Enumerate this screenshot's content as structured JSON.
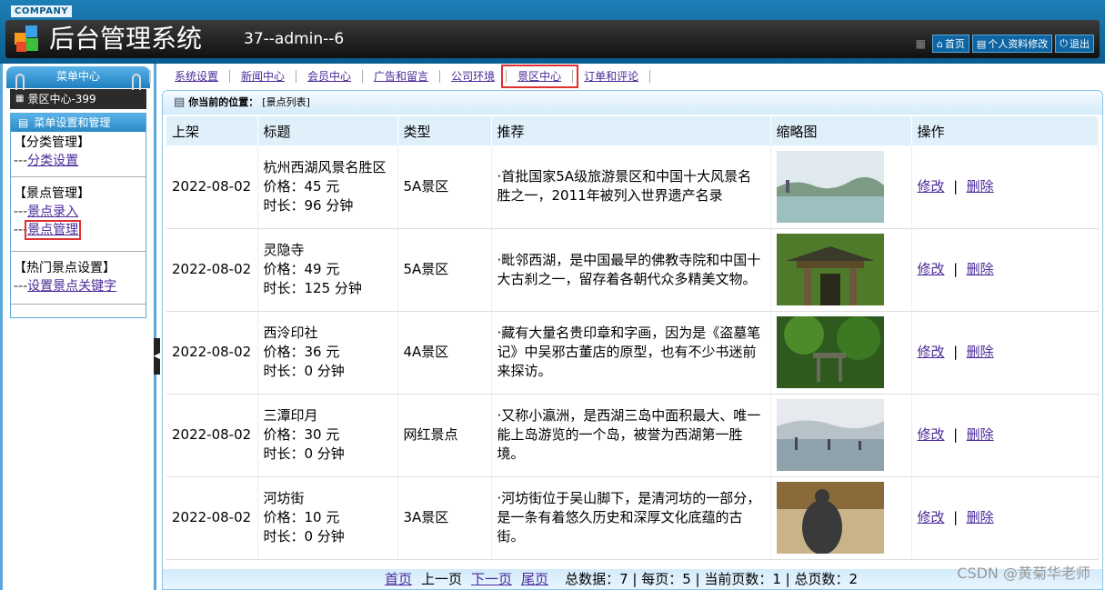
{
  "header": {
    "company": "COMPANY",
    "title": "后台管理系统",
    "user": "37--admin--6",
    "links": [
      "首页",
      "个人资料修改",
      "退出"
    ]
  },
  "sidebar": {
    "menu_title": "菜单中心",
    "center_label": "景区中心-399",
    "box_title": "菜单设置和管理",
    "groups": [
      {
        "title": "【分类管理】",
        "items": [
          "分类设置"
        ]
      },
      {
        "title": "【景点管理】",
        "items": [
          "景点录入",
          "景点管理"
        ]
      },
      {
        "title": "【热门景点设置】",
        "items": [
          "设置景点关键字"
        ]
      }
    ]
  },
  "tabs": [
    "系统设置",
    "新闻中心",
    "会员中心",
    "广告和留言",
    "公司环境",
    "景区中心",
    "订单和评论"
  ],
  "location": {
    "label": "你当前的位置：",
    "value": "[景点列表]"
  },
  "table": {
    "headers": [
      "上架",
      "标题",
      "类型",
      "推荐",
      "缩略图",
      "操作"
    ],
    "rows": [
      {
        "date": "2022-08-02",
        "title": "杭州西湖风景名胜区",
        "price": "价格：45 元",
        "duration": "时长：96 分钟",
        "type": "5A景区",
        "desc": "·首批国家5A级旅游景区和中国十大风景名胜之一，2011年被列入世界遗产名录",
        "thumb": "lake-scene"
      },
      {
        "date": "2022-08-02",
        "title": "灵隐寺",
        "price": "价格：49 元",
        "duration": "时长：125 分钟",
        "type": "5A景区",
        "desc": "·毗邻西湖，是中国最早的佛教寺院和中国十大古刹之一，留存着各朝代众多精美文物。",
        "thumb": "temple-gate"
      },
      {
        "date": "2022-08-02",
        "title": "西泠印社",
        "price": "价格：36 元",
        "duration": "时长：0 分钟",
        "type": "4A景区",
        "desc": "·藏有大量名贵印章和字画，因为是《盗墓笔记》中吴邪古董店的原型，也有不少书迷前来探访。",
        "thumb": "garden-pavilion"
      },
      {
        "date": "2022-08-02",
        "title": "三潭印月",
        "price": "价格：30 元",
        "duration": "时长：0 分钟",
        "type": "网红景点",
        "desc": "·又称小瀛洲，是西湖三岛中面积最大、唯一能上岛游览的一个岛，被誉为西湖第一胜境。",
        "thumb": "misty-lake"
      },
      {
        "date": "2022-08-02",
        "title": "河坊街",
        "price": "价格：10 元",
        "duration": "时长：0 分钟",
        "type": "3A景区",
        "desc": "·河坊街位于吴山脚下，是清河坊的一部分，是一条有着悠久历史和深厚文化底蕴的古街。",
        "thumb": "statue-street"
      }
    ],
    "edit": "修改",
    "sep": "|",
    "delete": "删除"
  },
  "pager": {
    "first": "首页",
    "prev": "上一页",
    "next": "下一页",
    "last": "尾页",
    "stats": "总数据：7 | 每页：5 | 当前页数：1 | 总页数：2"
  },
  "watermark": "CSDN @黄菊华老师"
}
